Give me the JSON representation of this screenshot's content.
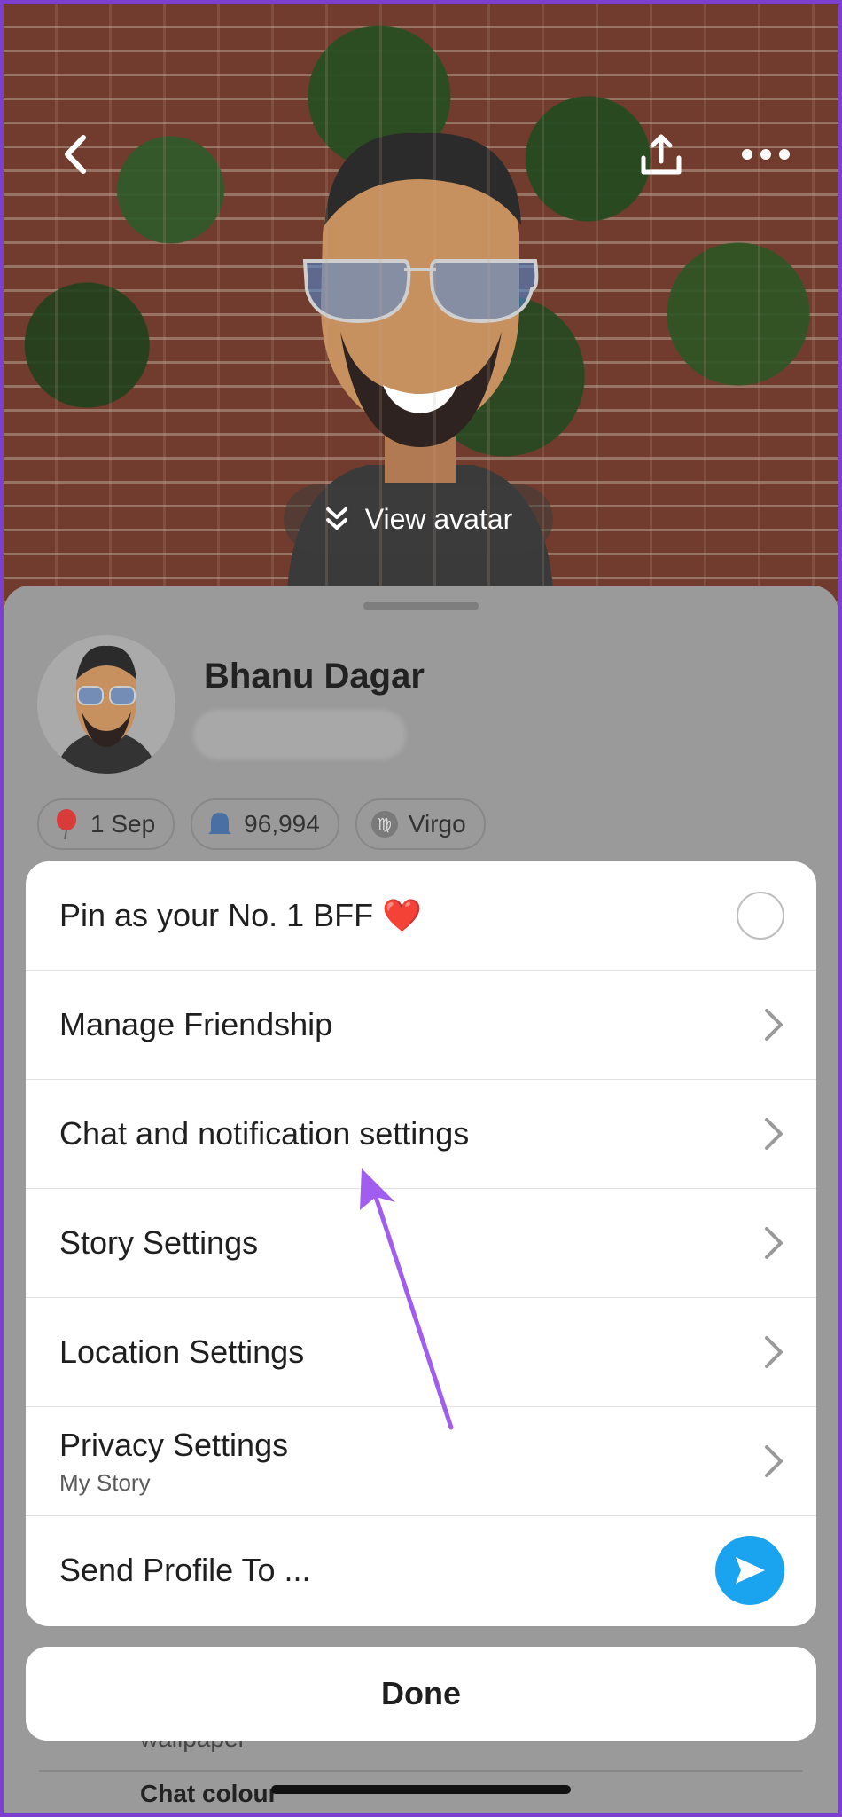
{
  "hero": {
    "view_avatar_label": "View avatar"
  },
  "profile": {
    "name": "Bhanu Dagar",
    "chips": [
      {
        "icon": "balloon-icon",
        "label": "1 Sep"
      },
      {
        "icon": "ghost-icon",
        "label": "96,994"
      },
      {
        "icon": "virgo-icon",
        "label": "Virgo"
      }
    ]
  },
  "menu": {
    "items": [
      {
        "label": "Pin as your No. 1 BFF ❤️",
        "control": "radio"
      },
      {
        "label": "Manage Friendship",
        "control": "chevron"
      },
      {
        "label": "Chat and notification settings",
        "control": "chevron"
      },
      {
        "label": "Story Settings",
        "control": "chevron"
      },
      {
        "label": "Location Settings",
        "control": "chevron"
      },
      {
        "label": "Privacy Settings",
        "sublabel": "My Story",
        "control": "chevron"
      },
      {
        "label": "Send Profile To ...",
        "control": "send"
      }
    ]
  },
  "done_label": "Done",
  "background_rows": {
    "wallpaper": "wallpaper",
    "chat_colour": "Chat colour"
  },
  "colors": {
    "annotation_arrow": "#a05df0",
    "send_button": "#1aa3ef"
  }
}
